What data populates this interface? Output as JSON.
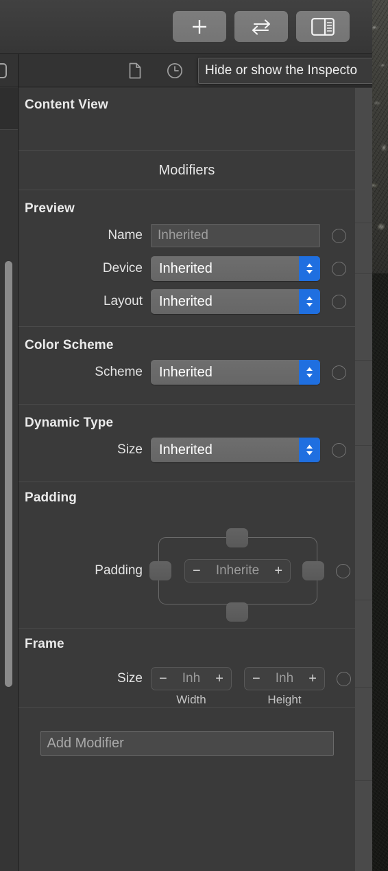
{
  "window": {
    "toolbar": {
      "buttons": [
        {
          "name": "add-button",
          "icon": "plus-icon",
          "label": "+"
        },
        {
          "name": "swap-button",
          "icon": "arrow-swap-icon",
          "label": "⇄"
        },
        {
          "name": "toggle-inspector-button",
          "icon": "inspector-panel-icon",
          "label": ""
        }
      ]
    },
    "tooltip": {
      "text": "Hide or show the Inspecto"
    },
    "tabbar": {
      "icons": [
        {
          "name": "file-tab",
          "icon": "document-icon"
        },
        {
          "name": "history-tab",
          "icon": "clock-icon"
        }
      ]
    }
  },
  "inspector": {
    "header": {
      "title": "Content View"
    },
    "modifiers_header": "Modifiers",
    "sections": [
      {
        "id": "preview",
        "title": "Preview",
        "rows": [
          {
            "label": "Name",
            "control": "textfield",
            "value": "Inherited",
            "placeholder": "Inherited"
          },
          {
            "label": "Device",
            "control": "popup",
            "value": "Inherited"
          },
          {
            "label": "Layout",
            "control": "popup",
            "value": "Inherited"
          }
        ]
      },
      {
        "id": "color-scheme",
        "title": "Color Scheme",
        "rows": [
          {
            "label": "Scheme",
            "control": "popup",
            "value": "Inherited"
          }
        ]
      },
      {
        "id": "dynamic-type",
        "title": "Dynamic Type",
        "rows": [
          {
            "label": "Size",
            "control": "popup",
            "value": "Inherited"
          }
        ]
      },
      {
        "id": "padding",
        "title": "Padding",
        "rows": [
          {
            "label": "Padding",
            "control": "padding-widget",
            "value": "Inherite",
            "minus": "−",
            "plus": "+"
          }
        ]
      },
      {
        "id": "frame",
        "title": "Frame",
        "rows": [
          {
            "label": "Size",
            "control": "dual-stepper",
            "width": {
              "value": "Inh",
              "caption": "Width",
              "minus": "−",
              "plus": "+"
            },
            "height": {
              "value": "Inh",
              "caption": "Height",
              "minus": "−",
              "plus": "+"
            }
          }
        ]
      }
    ],
    "add_modifier": {
      "placeholder": "Add Modifier"
    }
  },
  "colors": {
    "accent_blue": "#1f6fe0",
    "panel_bg": "#3a3a3a",
    "toolbar_bg": "#3b3b3b",
    "text_primary": "#eaeaea",
    "text_muted": "#9d9d9d"
  }
}
